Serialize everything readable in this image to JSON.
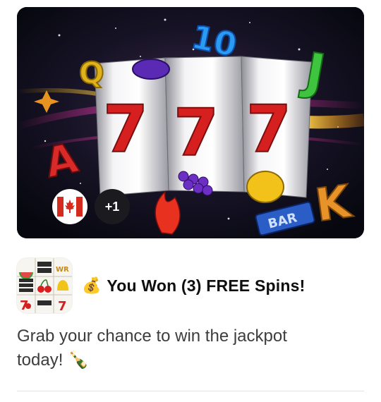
{
  "card": {
    "hero_image": "slot-machine-777-reels-illustration",
    "region_flag": "canada-flag-icon",
    "extra_regions_label": "+1",
    "app_icon": "slot-machine-symbols-icon",
    "title_emoji": "💰",
    "title": "You Won (3) FREE Spins!",
    "description_line1": "Grab your chance to win the jackpot",
    "description_line2": "today! 🍾"
  },
  "colors": {
    "hero_background": "#0b0d1a",
    "seven_red": "#d6201f",
    "badge_dark": "#1b1b1f",
    "canada_red": "#d52b1e",
    "title_text": "#0f0f0f",
    "body_text": "#3d3d3d",
    "divider": "#e3e3e3"
  }
}
